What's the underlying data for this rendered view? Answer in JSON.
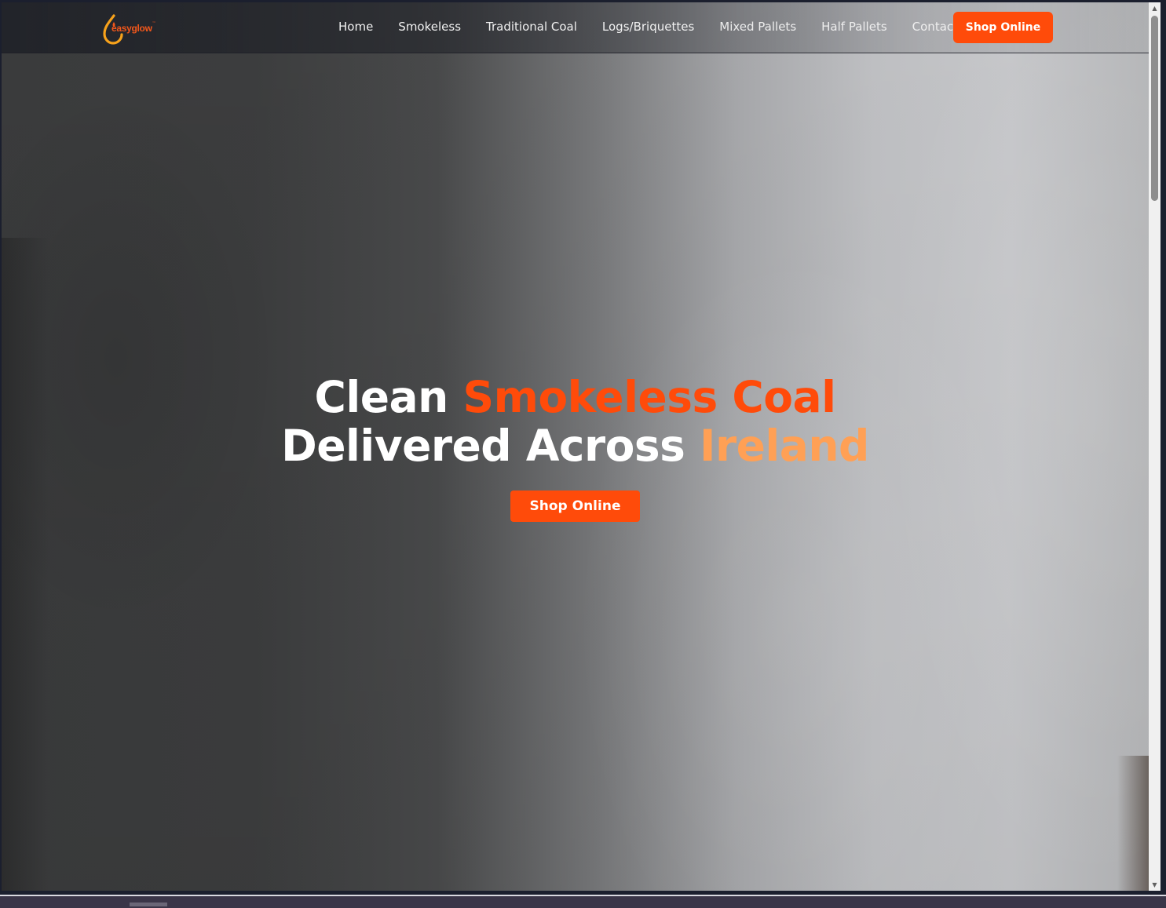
{
  "brand": {
    "name": "easyglow",
    "trademark": "™",
    "colors": {
      "primary": "#ff4b0a",
      "accent_light": "#ffa055",
      "logo_flame": "#f7a21b"
    }
  },
  "nav": {
    "items": [
      {
        "label": "Home"
      },
      {
        "label": "Smokeless"
      },
      {
        "label": "Traditional Coal"
      },
      {
        "label": "Logs/Briquettes"
      },
      {
        "label": "Mixed Pallets"
      },
      {
        "label": "Half Pallets"
      },
      {
        "label": "Contact"
      }
    ],
    "cta_label": "Shop Online"
  },
  "hero": {
    "title_part1": "Clean ",
    "title_accent": "Smokeless Coal",
    "title_part2": "Delivered Across ",
    "title_accent2": "Ireland",
    "cta_label": "Shop Online"
  },
  "icons": {
    "logo": "flame-drop-icon",
    "scroll_up": "scroll-up-arrow-icon",
    "scroll_down": "scroll-down-arrow-icon"
  }
}
